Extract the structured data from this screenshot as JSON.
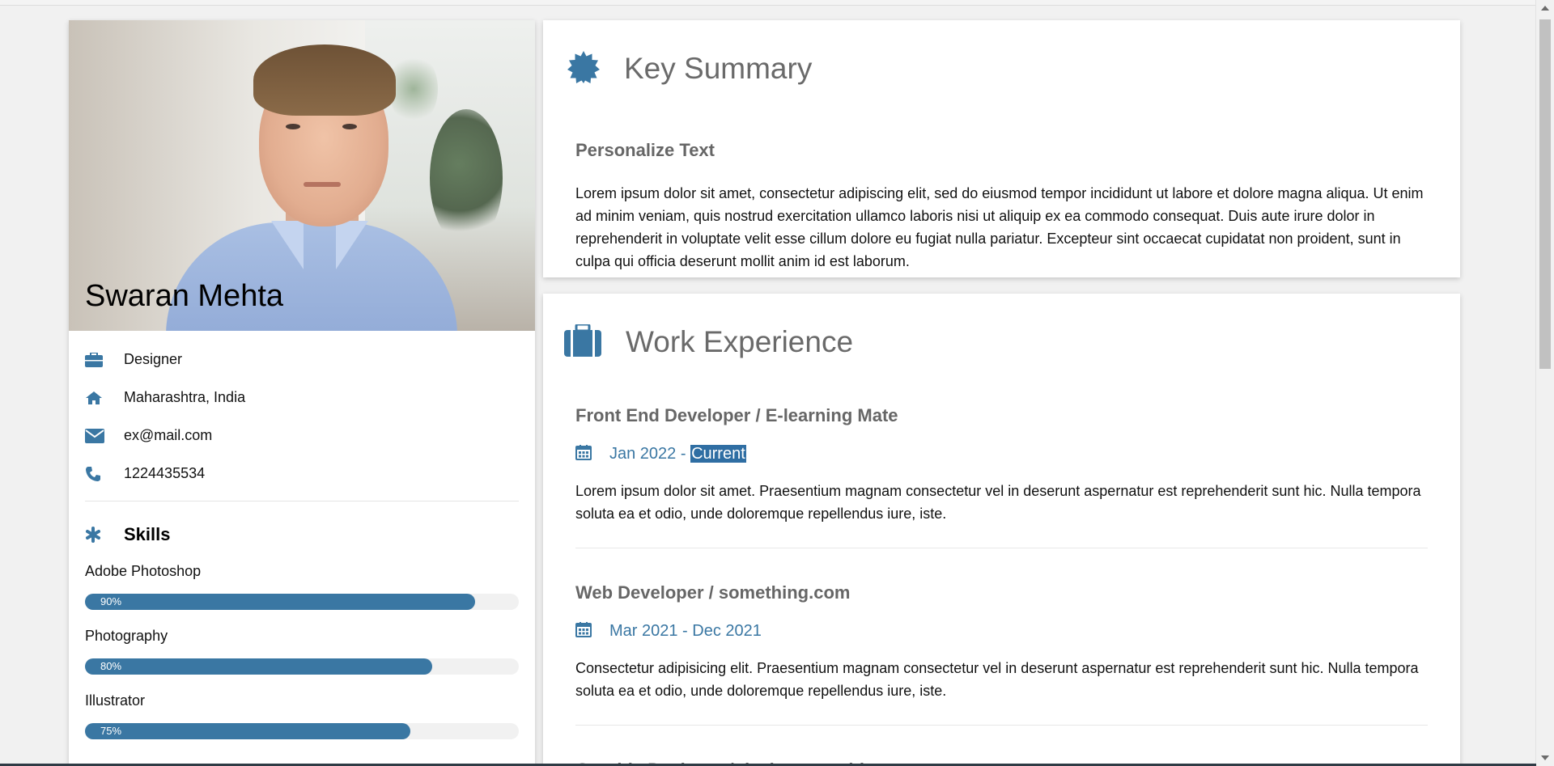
{
  "profile": {
    "name": "Swaran Mehta",
    "job_title": "Designer",
    "location": "Maharashtra, India",
    "email": "ex@mail.com",
    "phone": "1224435534"
  },
  "skills": {
    "title": "Skills",
    "items": [
      {
        "label": "Adobe Photoshop",
        "percent_label": "90%",
        "value": 90
      },
      {
        "label": "Photography",
        "percent_label": "80%",
        "value": 80
      },
      {
        "label": "Illustrator",
        "percent_label": "75%",
        "value": 75
      }
    ]
  },
  "summary": {
    "title": "Key Summary",
    "subtitle": "Personalize Text",
    "text": "Lorem ipsum dolor sit amet, consectetur adipiscing elit, sed do eiusmod tempor incididunt ut labore et dolore magna aliqua. Ut enim ad minim veniam, quis nostrud exercitation ullamco laboris nisi ut aliquip ex ea commodo consequat. Duis aute irure dolor in reprehenderit in voluptate velit esse cillum dolore eu fugiat nulla pariatur. Excepteur sint occaecat cupidatat non proident, sunt in culpa qui officia deserunt mollit anim id est laborum."
  },
  "work": {
    "title": "Work Experience",
    "jobs": [
      {
        "title": "Front End Developer / E-learning Mate",
        "date_start": "Jan 2022 - ",
        "date_end": "Current",
        "description": "Lorem ipsum dolor sit amet. Praesentium magnam consectetur vel in deserunt aspernatur est reprehenderit sunt hic. Nulla tempora soluta ea et odio, unde doloremque repellendus iure, iste."
      },
      {
        "title": "Web Developer / something.com",
        "date": "Mar 2021 - Dec 2021",
        "description": "Consectetur adipisicing elit. Praesentium magnam consectetur vel in deserunt aspernatur est reprehenderit sunt hic. Nulla tempora soluta ea et odio, unde doloremque repellendus iure, iste."
      },
      {
        "title": "Graphic Designer / designsomething.com"
      }
    ]
  },
  "colors": {
    "accent": "#3a77a3",
    "heading": "#6a6a6a",
    "background": "#f1f1f1"
  },
  "icons": {
    "job": "briefcase-icon",
    "location": "home-icon",
    "email": "envelope-icon",
    "phone": "phone-icon",
    "skills": "asterisk-icon",
    "summary": "certificate-icon",
    "work": "briefcase-large-icon",
    "date": "calendar-icon"
  }
}
